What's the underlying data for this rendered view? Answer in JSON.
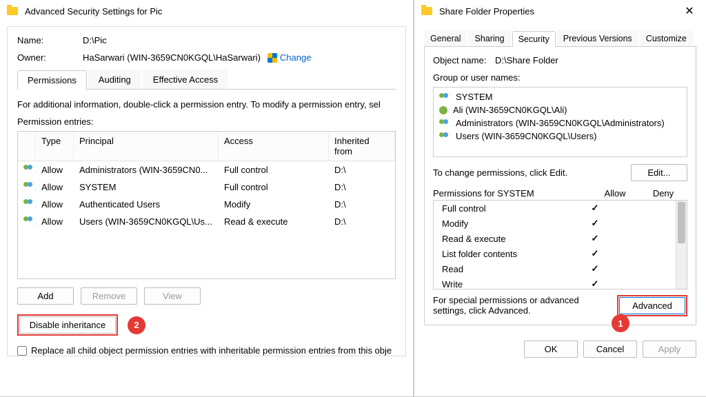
{
  "advsec": {
    "title": "Advanced Security Settings for Pic",
    "name_label": "Name:",
    "name_value": "D:\\Pic",
    "owner_label": "Owner:",
    "owner_value": "HaSarwari (WIN-3659CN0KGQL\\HaSarwari)",
    "change_link": "Change",
    "tabs": [
      "Permissions",
      "Auditing",
      "Effective Access"
    ],
    "info": "For additional information, double-click a permission entry. To modify a permission entry, sel",
    "entries_label": "Permission entries:",
    "headers": {
      "type": "Type",
      "principal": "Principal",
      "access": "Access",
      "inherited": "Inherited from"
    },
    "entries": [
      {
        "type": "Allow",
        "principal": "Administrators (WIN-3659CN0...",
        "access": "Full control",
        "inherited": "D:\\"
      },
      {
        "type": "Allow",
        "principal": "SYSTEM",
        "access": "Full control",
        "inherited": "D:\\"
      },
      {
        "type": "Allow",
        "principal": "Authenticated Users",
        "access": "Modify",
        "inherited": "D:\\"
      },
      {
        "type": "Allow",
        "principal": "Users (WIN-3659CN0KGQL\\Us...",
        "access": "Read & execute",
        "inherited": "D:\\"
      }
    ],
    "buttons": {
      "add": "Add",
      "remove": "Remove",
      "view": "View",
      "disable": "Disable inheritance"
    },
    "checkbox": "Replace all child object permission entries with inheritable permission entries from this obje",
    "anno2": "2"
  },
  "props": {
    "title": "Share Folder Properties",
    "tabs": [
      "General",
      "Sharing",
      "Security",
      "Previous Versions",
      "Customize"
    ],
    "object_label": "Object name:",
    "object_value": "D:\\Share Folder",
    "group_label": "Group or user names:",
    "groups": [
      "SYSTEM",
      "Ali (WIN-3659CN0KGQL\\Ali)",
      "Administrators (WIN-3659CN0KGQL\\Administrators)",
      "Users (WIN-3659CN0KGQL\\Users)"
    ],
    "change_hint": "To change permissions, click Edit.",
    "edit_btn": "Edit...",
    "perm_for": "Permissions for SYSTEM",
    "allow": "Allow",
    "deny": "Deny",
    "perms": [
      "Full control",
      "Modify",
      "Read & execute",
      "List folder contents",
      "Read",
      "Write"
    ],
    "adv_hint": "For special permissions or advanced settings, click Advanced.",
    "adv_btn": "Advanced",
    "anno1": "1",
    "footer": {
      "ok": "OK",
      "cancel": "Cancel",
      "apply": "Apply"
    }
  }
}
